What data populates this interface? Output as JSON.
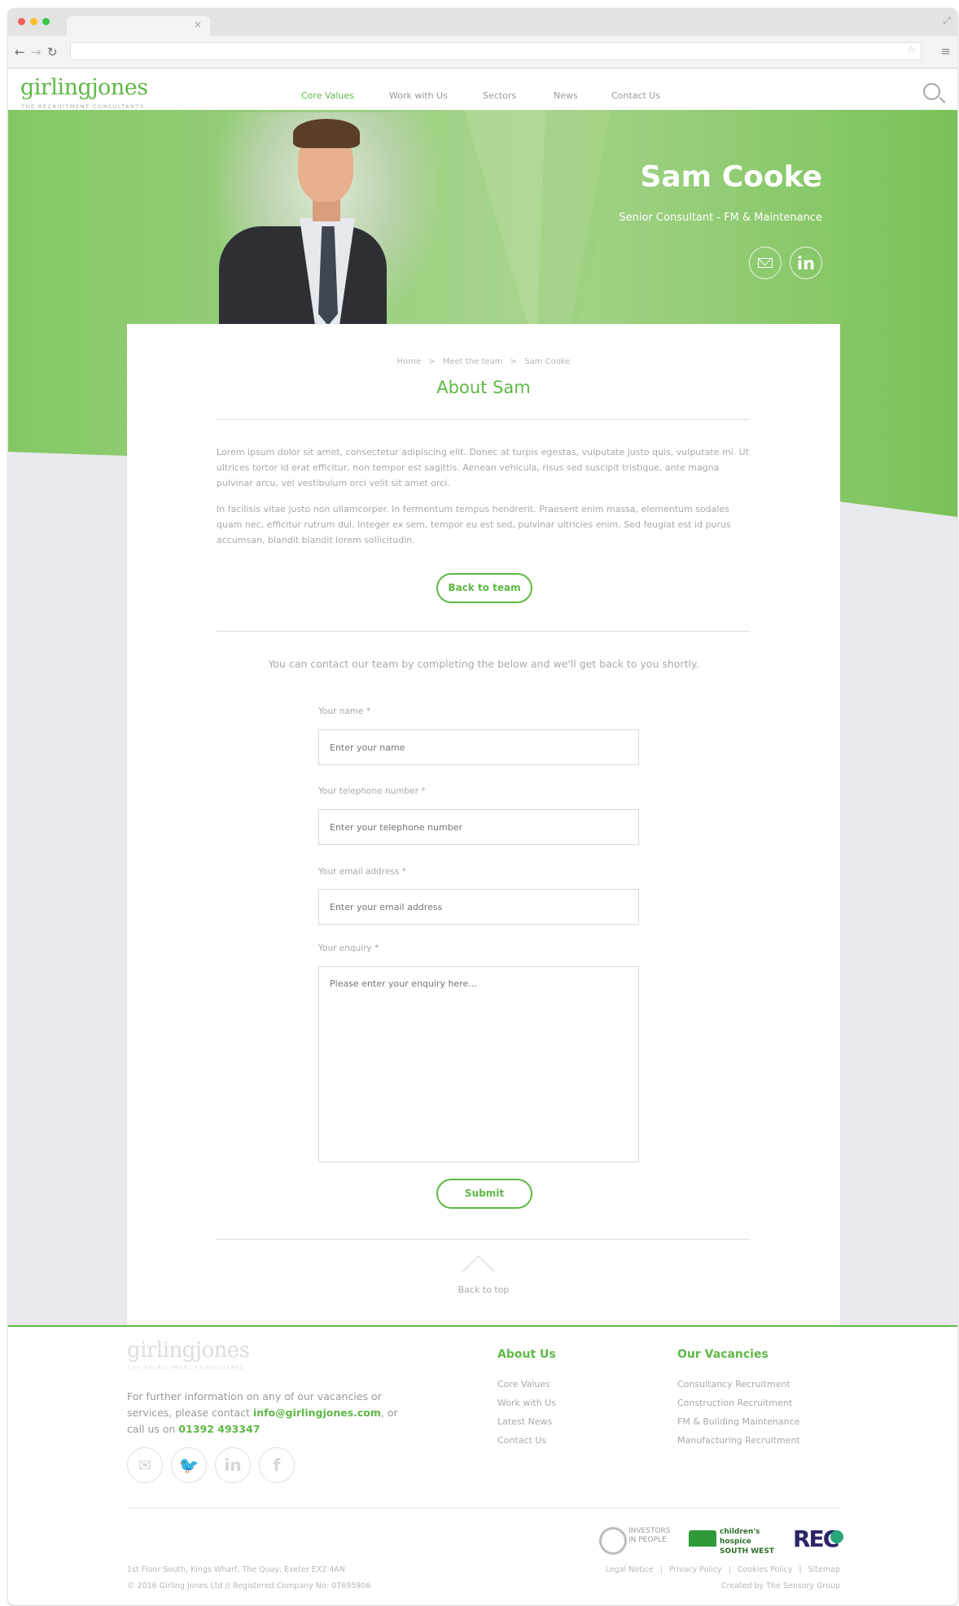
{
  "colors": {
    "brand_green": "#5fb847",
    "hero_green": "#7bc55b",
    "page_bg": "#e9eaed"
  },
  "header": {
    "logo": "girlingjones",
    "logo_tagline": "THE RECRUITMENT CONSULTANTS",
    "nav": [
      {
        "label": "Core Values",
        "active": true
      },
      {
        "label": "Work with Us",
        "active": false
      },
      {
        "label": "Sectors",
        "active": false
      },
      {
        "label": "News",
        "active": false
      },
      {
        "label": "Contact Us",
        "active": false
      }
    ],
    "search_icon": "search-icon"
  },
  "hero": {
    "name": "Sam Cooke",
    "role": "Senior Consultant - FM & Maintenance",
    "email_icon": "envelope-icon",
    "linkedin_label": "in"
  },
  "profile": {
    "breadcrumb": [
      "Home",
      "Meet the team",
      "Sam Cooke"
    ],
    "breadcrumb_separator": ">",
    "title": "About Sam",
    "paragraphs": [
      "Lorem ipsum dolor sit amet, consectetur adipiscing elit. Donec at turpis egestas, vulputate justo quis, vulputate mi. Ut ultrices tortor id erat efficitur, non tempor est sagittis. Aenean vehicula, risus sed suscipit tristique, ante magna pulvinar arcu, vel vestibulum orci velit sit amet orci.",
      "In facilisis vitae justo non ullamcorper. In fermentum tempus hendrerit. Praesent enim massa, elementum sodales quam nec, efficitur rutrum dui. Integer ex sem, tempor eu est sed, pulvinar ultricies enim. Sed feugiat est id purus accumsan, blandit blandit lorem sollicitudin."
    ],
    "back_button": "Back to team"
  },
  "form": {
    "intro": "You can contact our team by completing the below and we'll get back to you shortly.",
    "fields": [
      {
        "label": "Your name *",
        "placeholder": "Enter your name"
      },
      {
        "label": "Your telephone number *",
        "placeholder": "Enter your telephone number"
      },
      {
        "label": "Your email address *",
        "placeholder": "Enter your email address"
      },
      {
        "label": "Your enquiry *",
        "placeholder": "Please enter your enquiry here..."
      }
    ],
    "submit": "Submit"
  },
  "back_to_top": "Back to top",
  "footer": {
    "logo": "girlingjones",
    "logo_tagline": "THE RECRUITMENT CONSULTANTS",
    "text_before": "For further information on any of our vacancies or services, please contact ",
    "email": "info@girlingjones.com",
    "text_mid": ", or call us on ",
    "phone": "01392 493347",
    "social": [
      {
        "icon": "email-icon",
        "glyph": "✉"
      },
      {
        "icon": "twitter-icon",
        "glyph": "🐦"
      },
      {
        "icon": "linkedin-icon",
        "glyph": "in"
      },
      {
        "icon": "facebook-icon",
        "glyph": "f"
      }
    ],
    "about_heading": "About Us",
    "about_links": [
      "Core Values",
      "Work with Us",
      "Latest News",
      "Contact Us"
    ],
    "vacancies_heading": "Our Vacancies",
    "vacancies_links": [
      "Consultancy Recruitment",
      "Construction Recruitment",
      "FM & Building Maintenance",
      "Manufacturing Recruitment"
    ],
    "badges": {
      "investors_line1": "INVESTORS",
      "investors_line2": "IN PEOPLE",
      "hospice_line1": "children's hospice",
      "hospice_line2": "SOUTH WEST",
      "rec": "REC"
    },
    "address": "1st Floor South, Kings Wharf, The Quay, Exeter EX2 4AN",
    "copyright": "© 2016 Girling Jones Ltd // Registered Company No: 07695906",
    "legal_links": [
      "Legal Notice",
      "Privacy Policy",
      "Cookies Policy",
      "Sitemap"
    ],
    "legal_separator": "|",
    "credit": "Created by The Sensory Group"
  }
}
